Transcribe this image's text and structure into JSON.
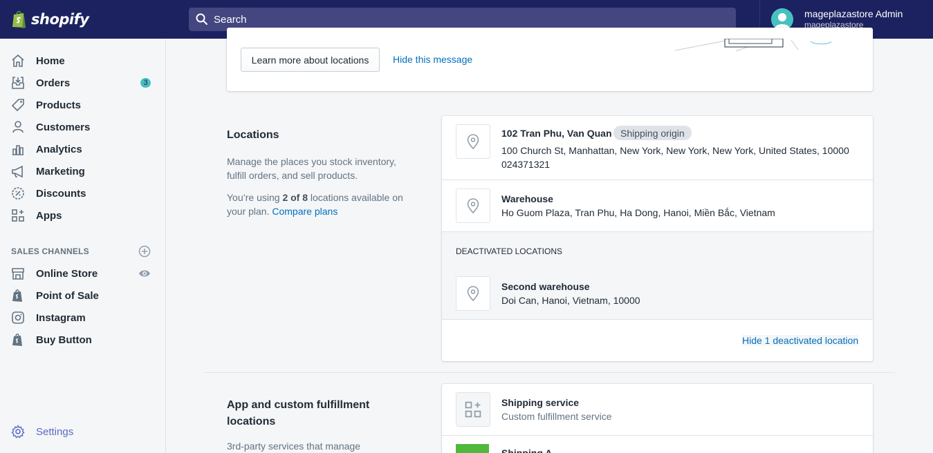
{
  "brand": {
    "name": "shopify"
  },
  "search": {
    "placeholder": "Search"
  },
  "user": {
    "name": "mageplazastore Admin",
    "store": "mageplazastore"
  },
  "sidebar": {
    "items": [
      {
        "label": "Home",
        "icon": "home-icon"
      },
      {
        "label": "Orders",
        "icon": "orders-icon",
        "badge": "3"
      },
      {
        "label": "Products",
        "icon": "tag-icon"
      },
      {
        "label": "Customers",
        "icon": "person-icon"
      },
      {
        "label": "Analytics",
        "icon": "bar-chart-icon"
      },
      {
        "label": "Marketing",
        "icon": "megaphone-icon"
      },
      {
        "label": "Discounts",
        "icon": "discount-icon"
      },
      {
        "label": "Apps",
        "icon": "apps-icon"
      }
    ],
    "sales_channels_title": "SALES CHANNELS",
    "channels": [
      {
        "label": "Online Store",
        "icon": "store-icon"
      },
      {
        "label": "Point of Sale",
        "icon": "shopify-bag-icon"
      },
      {
        "label": "Instagram",
        "icon": "instagram-icon"
      },
      {
        "label": "Buy Button",
        "icon": "shopify-bag-icon"
      }
    ],
    "settings_label": "Settings"
  },
  "banner": {
    "learn_button": "Learn more about locations",
    "hide_link": "Hide this message"
  },
  "locations": {
    "title": "Locations",
    "description": "Manage the places you stock inventory, fulfill orders, and sell products.",
    "usage_prefix": "You’re using ",
    "usage_count": "2 of 8",
    "usage_suffix": " locations available on your plan. ",
    "compare_link": "Compare plans",
    "items": [
      {
        "name": "102 Tran Phu, Van Quan",
        "badge": "Shipping origin",
        "address": "100 Church St, Manhattan, New York, New York, New York, United States, 10000",
        "phone": "024371321"
      },
      {
        "name": "Warehouse",
        "address": "Ho Guom Plaza, Tran Phu, Ha Dong, Hanoi, Miền Bắc, Vietnam"
      }
    ],
    "deactivated_title": "DEACTIVATED LOCATIONS",
    "deactivated": [
      {
        "name": "Second warehouse",
        "address": "Doi Can, Hanoi, Vietnam, 10000"
      }
    ],
    "hide_deactivated_link": "Hide 1 deactivated location"
  },
  "fulfillment": {
    "title": "App and custom fulfillment locations",
    "description": "3rd-party services that manage",
    "items": [
      {
        "name": "Shipping service",
        "subtitle": "Custom fulfillment service"
      },
      {
        "name": "Shipping A"
      }
    ]
  },
  "colors": {
    "topbar": "#1c2260",
    "accent": "#5c6ac4",
    "link": "#006fbb",
    "badge": "#47c1bf"
  }
}
